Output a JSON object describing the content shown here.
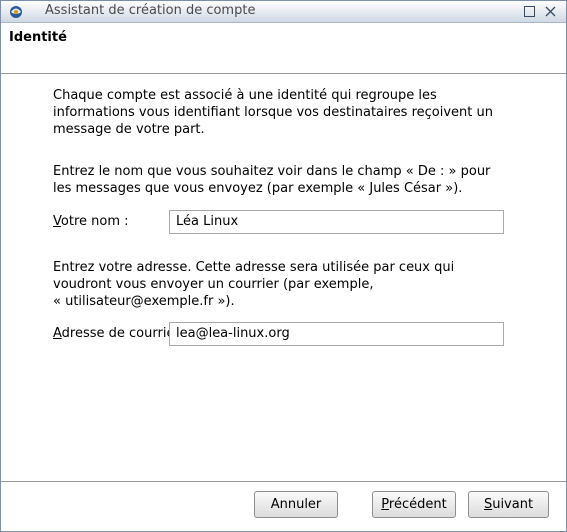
{
  "window": {
    "title": "Assistant de création de compte"
  },
  "header": {
    "title": "Identité"
  },
  "content": {
    "intro_paragraph": [
      "Chaque compte est associé à une identité qui regroupe les",
      "informations vous identifiant lorsque vos destinataires reçoivent un",
      "message de votre part."
    ],
    "name_instructions": [
      "Entrez le nom que vous souhaitez voir dans le champ « De : » pour",
      "les messages que vous envoyez (par exemple « Jules César »)."
    ],
    "name_field": {
      "label_first": "V",
      "label_rest": "otre nom :",
      "value": "Léa Linux"
    },
    "address_instructions": [
      "Entrez votre adresse. Cette adresse sera utilisée par ceux qui",
      "voudront vous envoyer un courrier (par exemple,",
      "« utilisateur@exemple.fr »)."
    ],
    "email_field": {
      "label_first": "A",
      "label_rest": "dresse de courrier :",
      "value": "lea@lea-linux.org"
    }
  },
  "footer": {
    "cancel_label": "Annuler",
    "previous_first": "P",
    "previous_rest": "récédent",
    "next_first": "S",
    "next_rest": "uivant"
  },
  "icons": {
    "app": "thunderbird-icon",
    "maximize": "maximize-icon",
    "close": "close-icon"
  }
}
